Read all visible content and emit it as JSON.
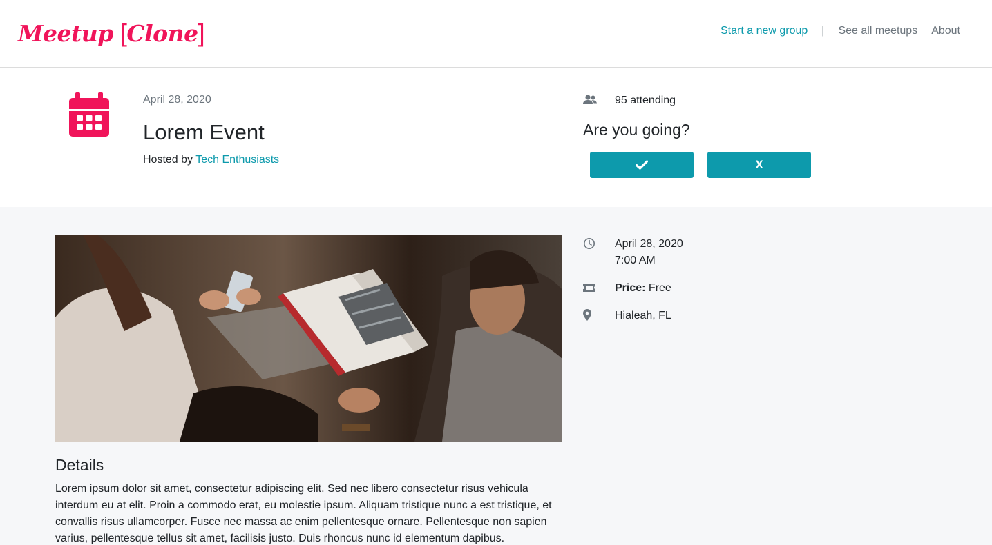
{
  "nav": {
    "brand_word": "Meetup",
    "brand_bracket_open": "[",
    "brand_sub": "Clone",
    "brand_bracket_close": "]",
    "start_group": "Start a new group",
    "separator": "|",
    "see_all": "See all meetups",
    "about": "About"
  },
  "event": {
    "date": "April 28, 2020",
    "title": "Lorem Event",
    "hosted_by_label": "Hosted by",
    "host": "Tech Enthusiasts"
  },
  "rsvp": {
    "attending": "95 attending",
    "question": "Are you going?",
    "no_label": "X",
    "yes_icon": "check-icon"
  },
  "info": {
    "date": "April 28, 2020",
    "time": "7:00 AM",
    "price_label": "Price:",
    "price_value": "Free",
    "location": "Hialeah, FL"
  },
  "details": {
    "title": "Details",
    "body": "Lorem ipsum dolor sit amet, consectetur adipiscing elit. Sed nec libero consectetur risus vehicula interdum eu at elit. Proin a commodo erat, eu molestie ipsum. Aliquam tristique nunc a est tristique, et convallis risus ullamcorper. Fusce nec massa ac enim pellentesque ornare. Pellentesque non sapien varius, pellentesque tellus sit amet, facilisis justo. Duis rhoncus nunc id elementum dapibus."
  },
  "colors": {
    "brand": "#f0145a",
    "accent": "#0d9aac",
    "muted": "#6c757d",
    "page_bg": "#f6f7f9"
  }
}
